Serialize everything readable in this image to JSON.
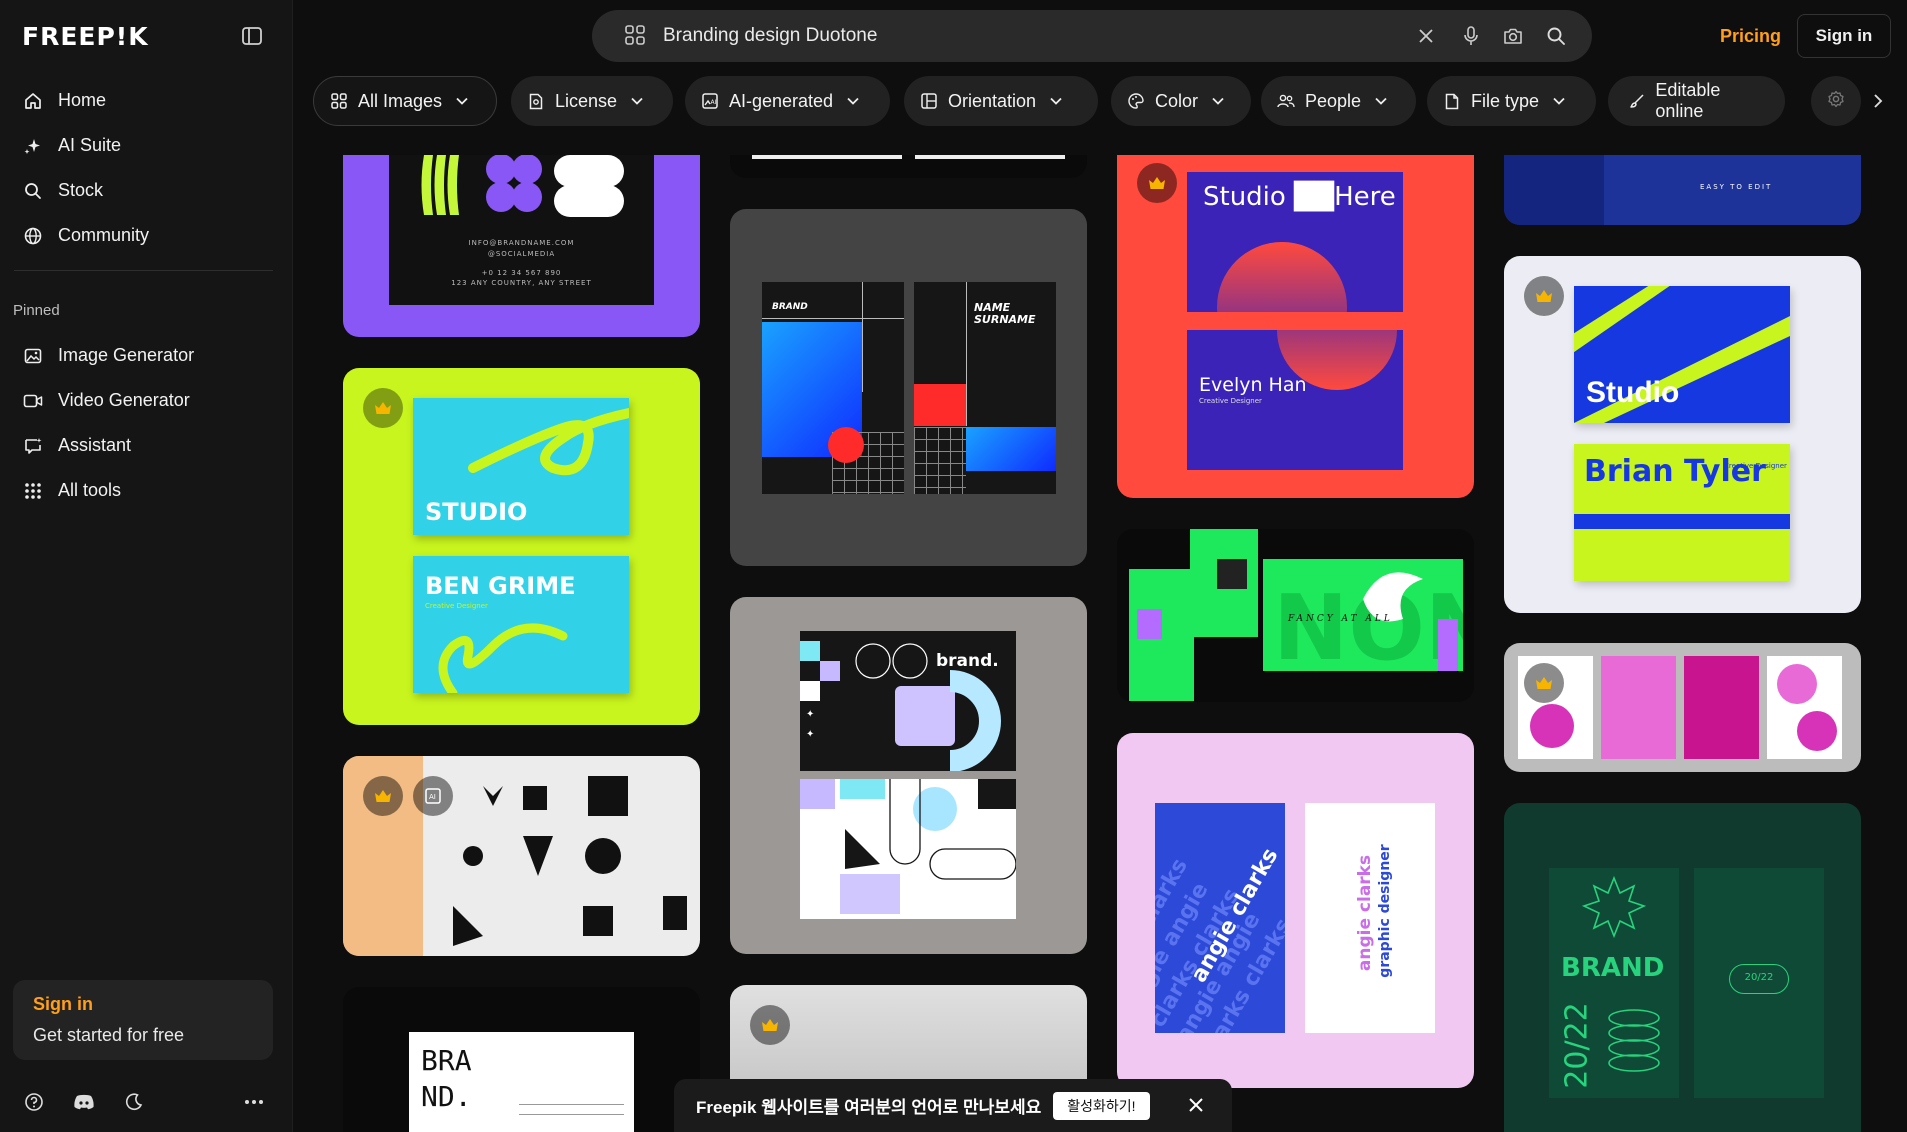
{
  "brand": {
    "logo": "FREEP!K"
  },
  "sidebar": {
    "nav": [
      {
        "label": "Home",
        "icon": "home-icon"
      },
      {
        "label": "AI Suite",
        "icon": "sparkle-icon"
      },
      {
        "label": "Stock",
        "icon": "search-icon"
      },
      {
        "label": "Community",
        "icon": "globe-icon"
      }
    ],
    "pinned_label": "Pinned",
    "pinned": [
      {
        "label": "Image Generator",
        "icon": "image-icon"
      },
      {
        "label": "Video Generator",
        "icon": "video-icon"
      },
      {
        "label": "Assistant",
        "icon": "chat-icon"
      },
      {
        "label": "All tools",
        "icon": "grid-icon"
      }
    ],
    "signin_card": {
      "title": "Sign in",
      "subtitle": "Get started for free"
    }
  },
  "search": {
    "value": "Branding design Duotone"
  },
  "header": {
    "pricing": "Pricing",
    "signin": "Sign in"
  },
  "filters": [
    {
      "label": "All Images"
    },
    {
      "label": "License"
    },
    {
      "label": "AI-generated"
    },
    {
      "label": "Orientation"
    },
    {
      "label": "Color"
    },
    {
      "label": "People"
    },
    {
      "label": "File type"
    },
    {
      "label": "Editable online"
    }
  ],
  "cards": {
    "studio_here": {
      "title": "Studio ██Here",
      "name": "Evelyn Han",
      "role": "Creative Designer"
    },
    "studio_ben": {
      "title": "STUDIO",
      "name": "BEN GRIME",
      "role": "Creative Designer"
    },
    "studio_brian": {
      "title": "Studio",
      "name": "Brian Tyler",
      "role": "Creative Designer"
    },
    "name_surname": {
      "left": "BRAND",
      "right": "NAME SURNAME"
    },
    "brand_dot": {
      "title": "brand."
    },
    "neon": {
      "text": "FANCY AT ALL"
    },
    "angie": {
      "front": "angie clarks",
      "back": "graphic designer"
    },
    "brand_green": {
      "title": "BRAND",
      "year": "20/22",
      "badge": "20/22"
    },
    "bra_nd": {
      "line1": "BRA",
      "line2": "ND."
    },
    "top_blue": {
      "text": "EASY TO EDIT"
    },
    "purple_card": {
      "line1": "INFO@BRANDNAME.COM",
      "line2": "@SOCIALMEDIA",
      "line3": "+0 12 34 567 890",
      "line4": "123 ANY COUNTRY, ANY STREET"
    }
  },
  "toast": {
    "text": "Freepik 웹사이트를 여러분의 언어로 만나보세요",
    "button": "활성화하기!"
  }
}
